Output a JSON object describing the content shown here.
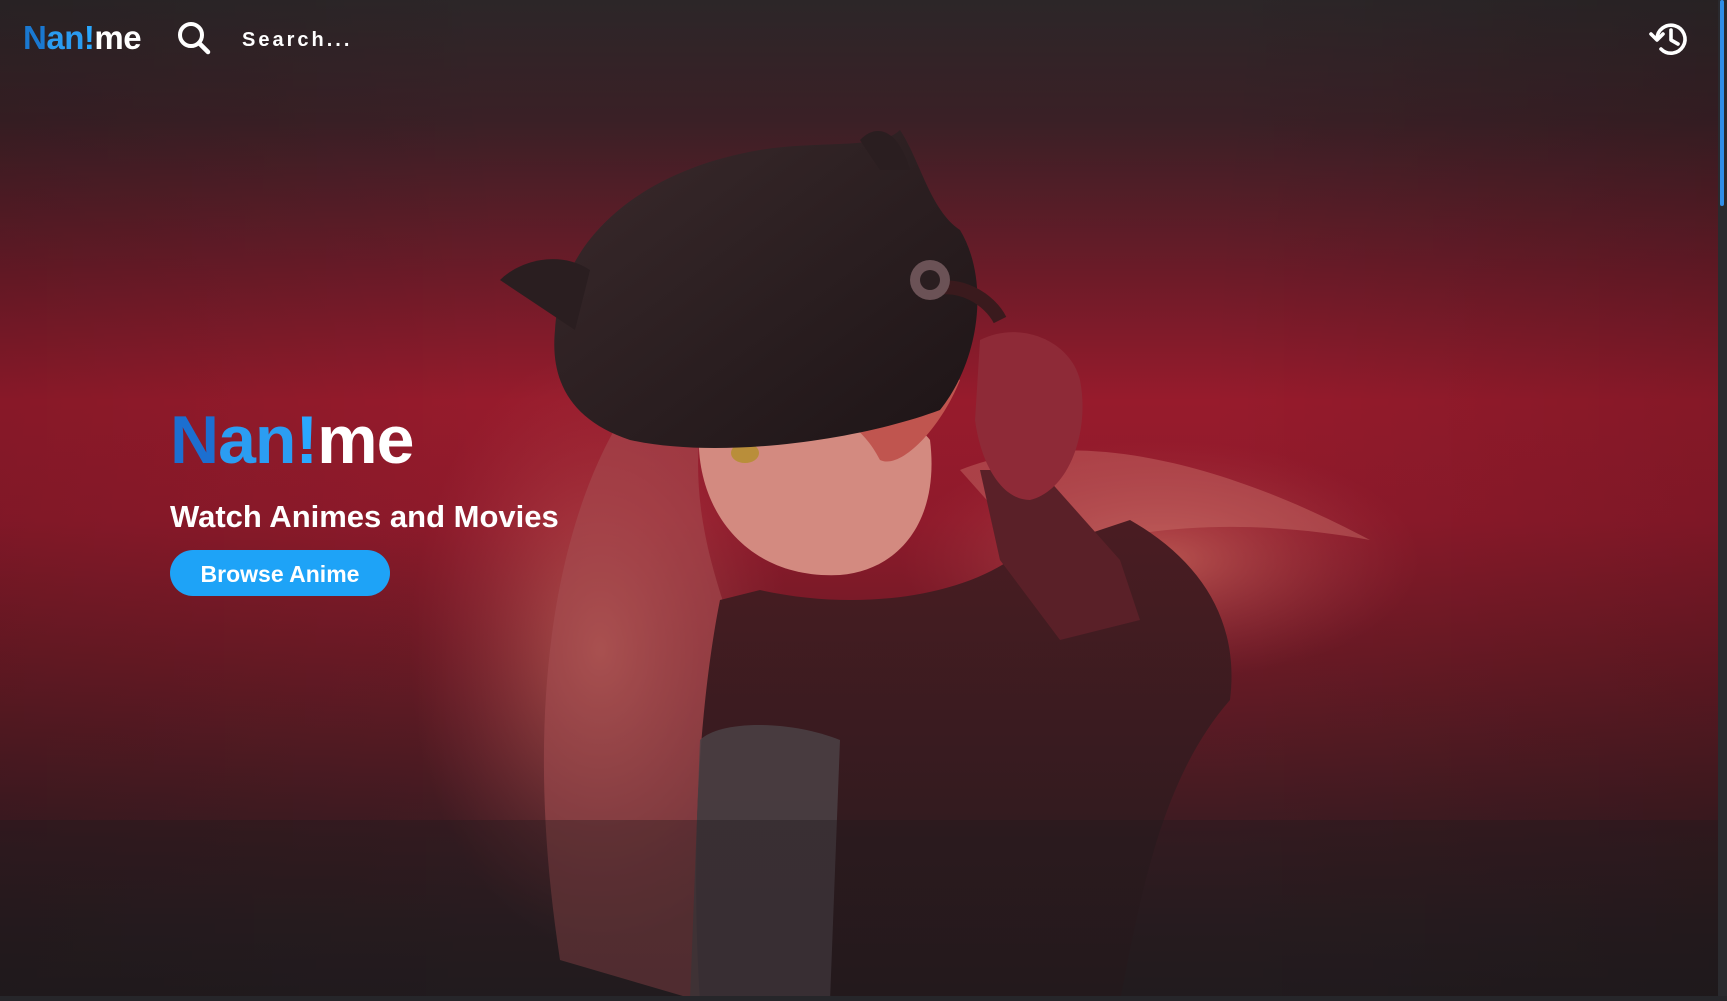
{
  "brand": {
    "logo_parts": [
      "N",
      "an",
      "!",
      "me"
    ],
    "hero_title_parts": [
      "N",
      "an",
      "!",
      "me"
    ]
  },
  "header": {
    "search_placeholder": "Search...",
    "search_icon": "search-icon",
    "history_icon": "history-icon"
  },
  "hero": {
    "subtitle": "Watch Animes and Movies",
    "browse_label": "Browse Anime",
    "background": "anime-figure-red-backdrop"
  },
  "colors": {
    "brand_blue": "#1c6fd0",
    "brand_light_blue": "#2b9df2",
    "button_blue": "#1ea3f7",
    "backdrop_red": "#971b2c",
    "scrollbar": "#2f8ee8"
  }
}
